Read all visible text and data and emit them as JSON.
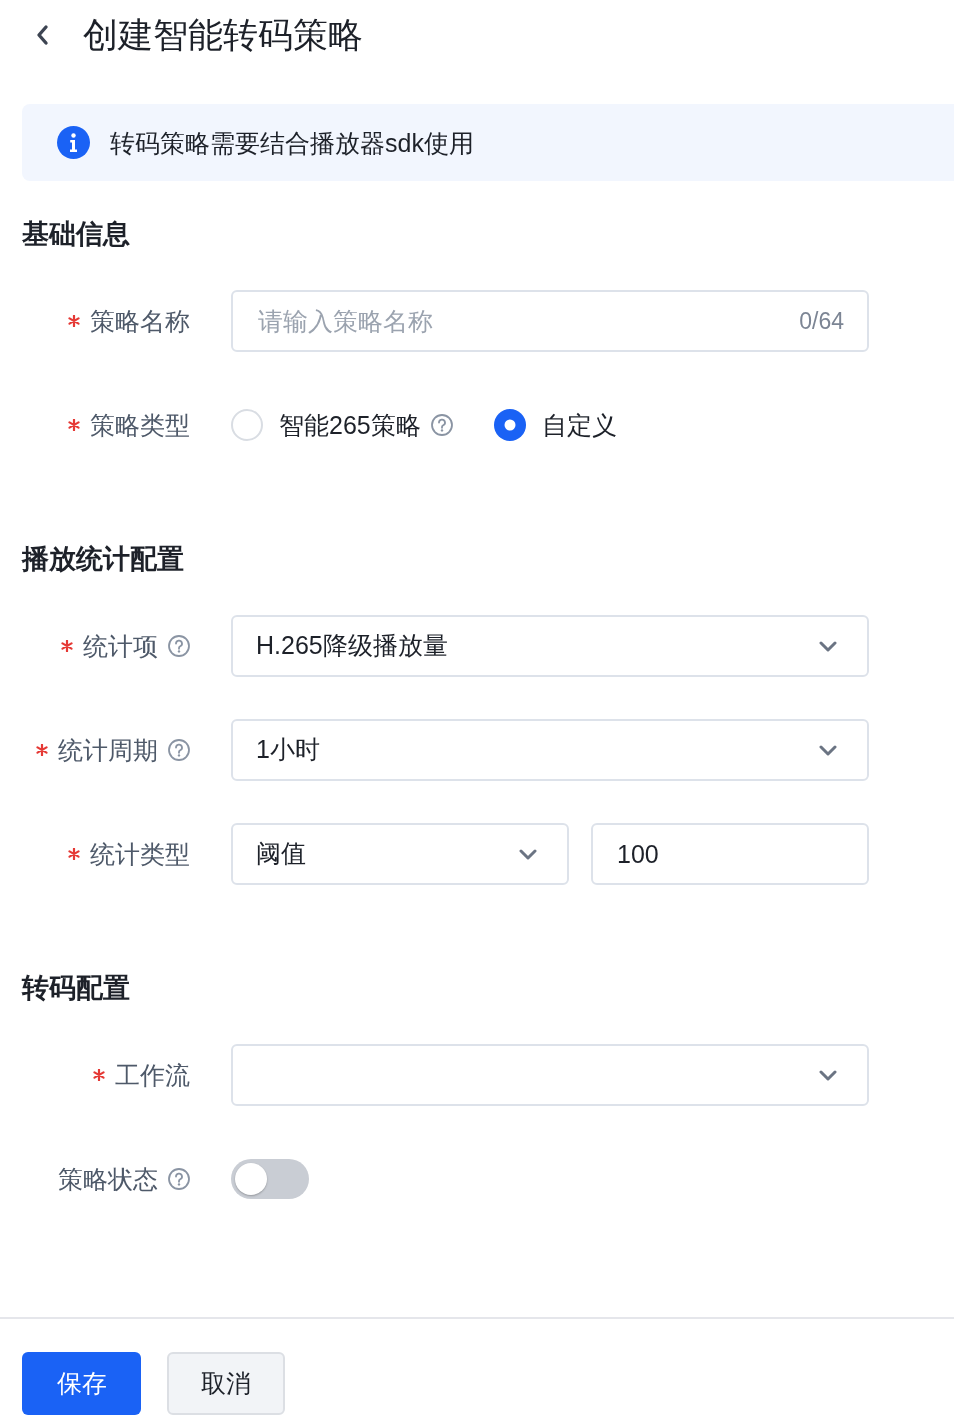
{
  "header": {
    "title": "创建智能转码策略"
  },
  "alert": {
    "text": "转码策略需要结合播放器sdk使用"
  },
  "sections": [
    {
      "title": "基础信息",
      "fields": [
        {
          "kind": "text",
          "label": "策略名称",
          "required": true,
          "placeholder": "请输入策略名称",
          "counter": "0/64"
        },
        {
          "kind": "radio",
          "label": "策略类型",
          "required": true,
          "options": [
            {
              "label": "智能265策略",
              "help": true,
              "selected": false
            },
            {
              "label": "自定义",
              "help": false,
              "selected": true
            }
          ]
        }
      ]
    },
    {
      "title": "播放统计配置",
      "fields": [
        {
          "kind": "select",
          "label": "统计项",
          "required": true,
          "help": true,
          "value": "H.265降级播放量"
        },
        {
          "kind": "select",
          "label": "统计周期",
          "required": true,
          "help": true,
          "value": "1小时"
        },
        {
          "kind": "select_input",
          "label": "统计类型",
          "required": true,
          "value": "阈值",
          "input_value": "100"
        }
      ]
    },
    {
      "title": "转码配置",
      "fields": [
        {
          "kind": "select",
          "label": "工作流",
          "required": true
        },
        {
          "kind": "toggle",
          "label": "策略状态",
          "required": false,
          "help": true,
          "on": false
        }
      ]
    }
  ],
  "buttons": [
    {
      "label": "保存",
      "kind": "primary"
    },
    {
      "label": "取消",
      "kind": "secondary"
    }
  ]
}
